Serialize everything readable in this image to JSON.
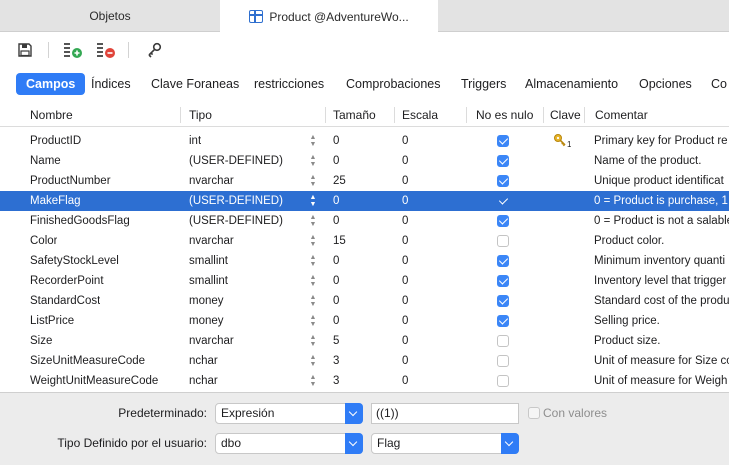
{
  "doc_tabs": [
    {
      "label": "Objetos"
    },
    {
      "label": "Product @AdventureWo..."
    }
  ],
  "toolbar": {
    "icons": [
      "save-icon",
      "add-field-icon",
      "delete-field-icon",
      "primary-key-icon"
    ]
  },
  "section_tabs": [
    "Campos",
    "Índices",
    "Clave Foraneas",
    "restricciones",
    "Comprobaciones",
    "Triggers",
    "Almacenamiento",
    "Opciones",
    "Co"
  ],
  "active_section": "Campos",
  "columns": {
    "name": "Nombre",
    "type": "Tipo",
    "size": "Tamaño",
    "scale": "Escala",
    "not_null": "No es nulo",
    "key": "Clave",
    "comment": "Comentar"
  },
  "rows": [
    {
      "name": "ProductID",
      "type": "int",
      "size": "0",
      "scale": "0",
      "not_null": true,
      "key": "1",
      "comment": "Primary key for Product re"
    },
    {
      "name": "Name",
      "type": "(USER-DEFINED)",
      "size": "0",
      "scale": "0",
      "not_null": true,
      "key": "",
      "comment": "Name of the product."
    },
    {
      "name": "ProductNumber",
      "type": "nvarchar",
      "size": "25",
      "scale": "0",
      "not_null": true,
      "key": "",
      "comment": "Unique product identificat"
    },
    {
      "name": "MakeFlag",
      "type": "(USER-DEFINED)",
      "size": "0",
      "scale": "0",
      "not_null": true,
      "key": "",
      "comment": "0 = Product is purchase, 1 ="
    },
    {
      "name": "FinishedGoodsFlag",
      "type": "(USER-DEFINED)",
      "size": "0",
      "scale": "0",
      "not_null": true,
      "key": "",
      "comment": "0 = Product is not a salable"
    },
    {
      "name": "Color",
      "type": "nvarchar",
      "size": "15",
      "scale": "0",
      "not_null": false,
      "key": "",
      "comment": "Product color."
    },
    {
      "name": "SafetyStockLevel",
      "type": "smallint",
      "size": "0",
      "scale": "0",
      "not_null": true,
      "key": "",
      "comment": "Minimum inventory quanti"
    },
    {
      "name": "RecorderPoint",
      "type": "smallint",
      "size": "0",
      "scale": "0",
      "not_null": true,
      "key": "",
      "comment": "Inventory level that trigger"
    },
    {
      "name": "StandardCost",
      "type": "money",
      "size": "0",
      "scale": "0",
      "not_null": true,
      "key": "",
      "comment": "Standard cost of the produ"
    },
    {
      "name": "ListPrice",
      "type": "money",
      "size": "0",
      "scale": "0",
      "not_null": true,
      "key": "",
      "comment": "Selling price."
    },
    {
      "name": "Size",
      "type": "nvarchar",
      "size": "5",
      "scale": "0",
      "not_null": false,
      "key": "",
      "comment": "Product size."
    },
    {
      "name": "SizeUnitMeasureCode",
      "type": "nchar",
      "size": "3",
      "scale": "0",
      "not_null": false,
      "key": "",
      "comment": "Unit of measure for Size co"
    },
    {
      "name": "WeightUnitMeasureCode",
      "type": "nchar",
      "size": "3",
      "scale": "0",
      "not_null": false,
      "key": "",
      "comment": "Unit of measure for Weigh"
    }
  ],
  "selected_row": "MakeFlag",
  "bottom": {
    "default_label": "Predeterminado:",
    "default_mode": "Expresión",
    "default_value": "((1))",
    "with_values_label": "Con valores",
    "udt_label": "Tipo Definido por el usuario:",
    "udt_schema": "dbo",
    "udt_name": "Flag"
  },
  "colors": {
    "accent": "#2f7cf6",
    "selection": "#2d6fd2"
  }
}
